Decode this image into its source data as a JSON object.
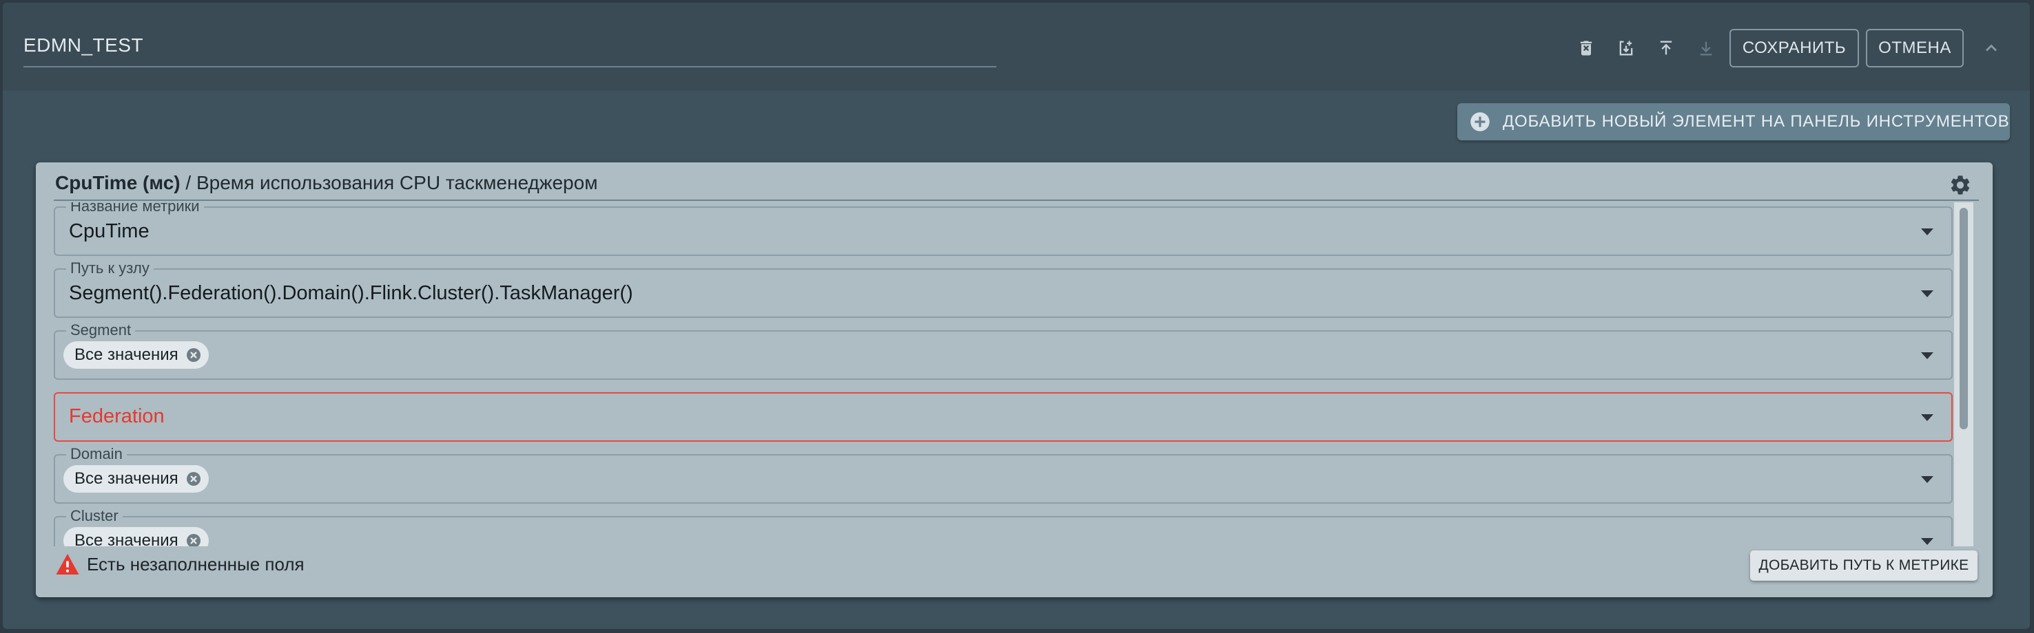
{
  "dashboard": {
    "title": "EDMN_TEST",
    "save_label": "СОХРАНИТЬ",
    "cancel_label": "ОТМЕНА",
    "add_toolbar_item_label": "ДОБАВИТЬ НОВЫЙ ЭЛЕМЕНТ НА ПАНЕЛЬ ИНСТРУМЕНТОВ",
    "icons": [
      "delete-icon",
      "import-icon",
      "upload-icon",
      "download-icon",
      "chevron-up-icon",
      "add-circle-icon"
    ]
  },
  "metric_card": {
    "title_bold": "CpuTime (мс)",
    "title_rest": " / Время использования CPU таскменеджером",
    "fields": [
      {
        "label": "Название метрики",
        "value": "CpuTime"
      },
      {
        "label": "Путь к узлу",
        "value": "Segment().Federation().Domain().Flink.Cluster().TaskManager()"
      },
      {
        "label": "Segment",
        "chip": "Все значения"
      },
      {
        "label": "",
        "placeholder": "Federation",
        "error": true
      },
      {
        "label": "Domain",
        "chip": "Все значения"
      },
      {
        "label": "Cluster",
        "chip": "Все значения"
      }
    ],
    "warning_text": "Есть незаполненные поля",
    "add_path_label": "ДОБАВИТЬ ПУТЬ К МЕТРИКЕ"
  },
  "colors": {
    "background": "#3e525d",
    "card": "#aebcc3",
    "error": "#e4392f",
    "accent_button": "#65808f"
  }
}
